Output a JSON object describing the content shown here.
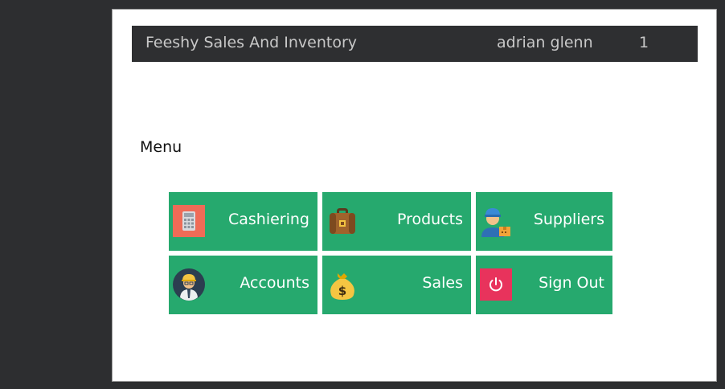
{
  "header": {
    "app_title": "Feeshy Sales And Inventory",
    "user_name": "adrian glenn",
    "user_count": "1"
  },
  "menu": {
    "title": "Menu",
    "items": [
      {
        "label": "Cashiering",
        "icon": "calculator-icon"
      },
      {
        "label": "Products",
        "icon": "briefcase-icon"
      },
      {
        "label": "Suppliers",
        "icon": "delivery-worker-icon"
      },
      {
        "label": "Accounts",
        "icon": "user-account-icon"
      },
      {
        "label": "Sales",
        "icon": "money-bag-icon"
      },
      {
        "label": "Sign Out",
        "icon": "power-icon"
      }
    ]
  },
  "colors": {
    "tile_green": "#26a96e",
    "header_bg": "#2e2f31",
    "desktop_bg": "#2d2e30",
    "calculator_bg": "#ef6b57",
    "power_bg": "#e8335c"
  }
}
